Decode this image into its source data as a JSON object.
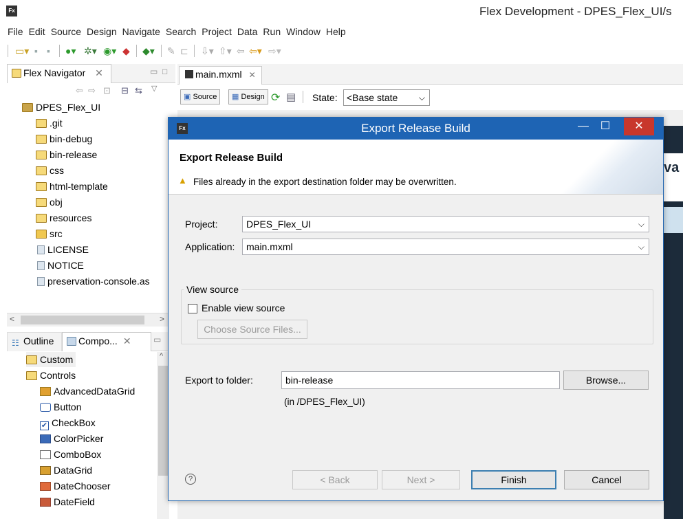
{
  "window": {
    "title": "Flex Development - DPES_Flex_UI/s",
    "app_icon": "Fx"
  },
  "menu": [
    "File",
    "Edit",
    "Source",
    "Design",
    "Navigate",
    "Search",
    "Project",
    "Data",
    "Run",
    "Window",
    "Help"
  ],
  "navigator": {
    "tab_label": "Flex Navigator",
    "project": "DPES_Flex_UI",
    "items": [
      ".git",
      "bin-debug",
      "bin-release",
      "css",
      "html-template",
      "obj",
      "resources",
      "src",
      "LICENSE",
      "NOTICE",
      "preservation-console.as"
    ]
  },
  "lower_panel": {
    "tabs": [
      "Outline",
      "Compo..."
    ],
    "items": [
      "Custom",
      "Controls",
      "AdvancedDataGrid",
      "Button",
      "CheckBox",
      "ColorPicker",
      "ComboBox",
      "DataGrid",
      "DateChooser",
      "DateField"
    ]
  },
  "editor": {
    "tab_label": "main.mxml",
    "source_label": "Source",
    "design_label": "Design",
    "state_label": "State:",
    "state_value": "<Base state",
    "canvas_partial_text": "va"
  },
  "dialog": {
    "title": "Export Release Build",
    "header_title": "Export Release Build",
    "header_message": "Files already in the export destination folder may be overwritten.",
    "project_label": "Project:",
    "project_value": "DPES_Flex_UI",
    "application_label": "Application:",
    "application_value": "main.mxml",
    "view_source_group": "View source",
    "enable_view_source": "Enable view source",
    "choose_source_files": "Choose Source Files...",
    "export_folder_label": "Export to folder:",
    "export_folder_value": "bin-release",
    "export_folder_note": "(in /DPES_Flex_UI)",
    "browse": "Browse...",
    "back": "< Back",
    "next": "Next >",
    "finish": "Finish",
    "cancel": "Cancel",
    "help": "?"
  },
  "icons": {
    "warning": "warning-icon",
    "folder": "folder-icon",
    "file": "file-icon"
  },
  "colors": {
    "dialog_title_bg": "#1e64b4",
    "close_btn": "#c8372c",
    "warning": "#d8a000"
  }
}
